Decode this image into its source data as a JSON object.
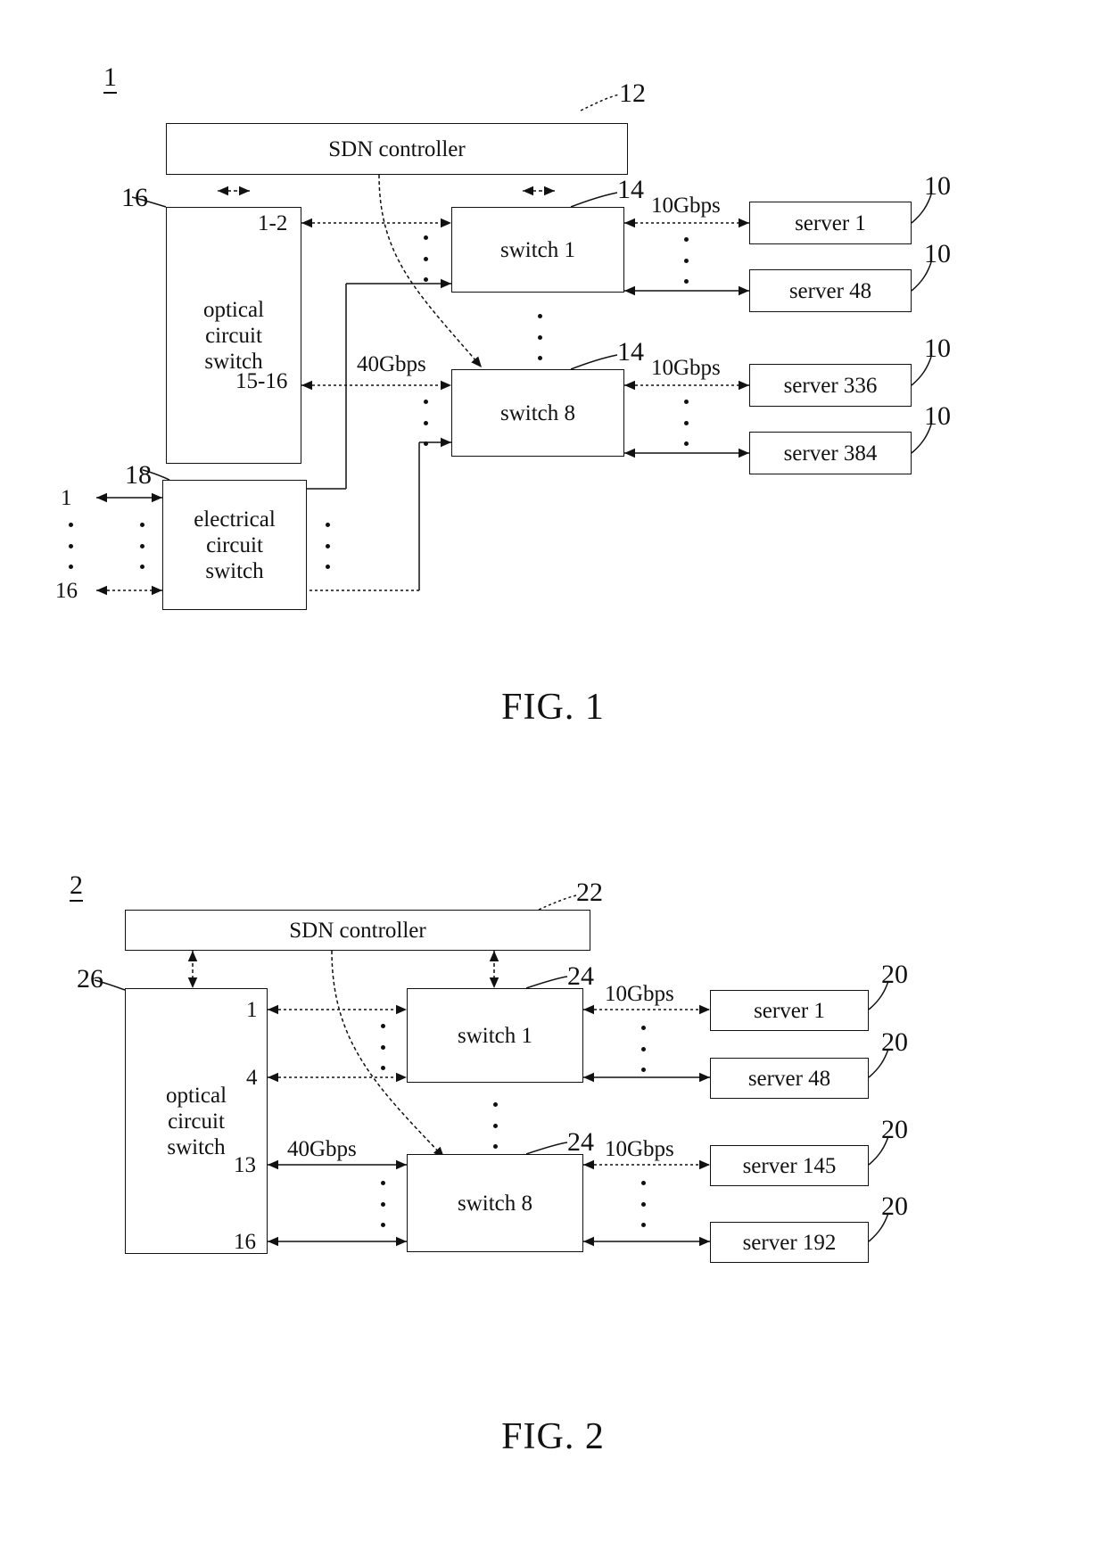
{
  "figures": [
    {
      "id": "fig1",
      "fig_number": "1",
      "caption": "FIG. 1",
      "controller": {
        "label": "SDN controller",
        "ref": "12"
      },
      "optical_switch": {
        "label_lines": [
          "optical",
          "circuit",
          "switch"
        ],
        "ref": "16",
        "ports": [
          "1-2",
          "15-16"
        ]
      },
      "electrical_switch": {
        "label_lines": [
          "electrical",
          "circuit",
          "switch"
        ],
        "ref": "18",
        "left_ports": [
          "1",
          "16"
        ]
      },
      "switches": [
        {
          "label": "switch 1",
          "ref": "14"
        },
        {
          "label": "switch 8",
          "ref": "14"
        }
      ],
      "servers": [
        {
          "label": "server 1",
          "ref": "10"
        },
        {
          "label": "server 48",
          "ref": "10"
        },
        {
          "label": "server 336",
          "ref": "10"
        },
        {
          "label": "server 384",
          "ref": "10"
        }
      ],
      "rates": {
        "uplink": "40Gbps",
        "downlink_top": "10Gbps",
        "downlink_bottom": "10Gbps"
      }
    },
    {
      "id": "fig2",
      "fig_number": "2",
      "caption": "FIG. 2",
      "controller": {
        "label": "SDN controller",
        "ref": "22"
      },
      "optical_switch": {
        "label_lines": [
          "optical",
          "circuit",
          "switch"
        ],
        "ref": "26",
        "ports": [
          "1",
          "4",
          "13",
          "16"
        ]
      },
      "switches": [
        {
          "label": "switch 1",
          "ref": "24"
        },
        {
          "label": "switch 8",
          "ref": "24"
        }
      ],
      "servers": [
        {
          "label": "server  1",
          "ref": "20"
        },
        {
          "label": "server 48",
          "ref": "20"
        },
        {
          "label": "server 145",
          "ref": "20"
        },
        {
          "label": "server 192",
          "ref": "20"
        }
      ],
      "rates": {
        "uplink": "40Gbps",
        "downlink_top": "10Gbps",
        "downlink_bottom": "10Gbps"
      }
    }
  ]
}
